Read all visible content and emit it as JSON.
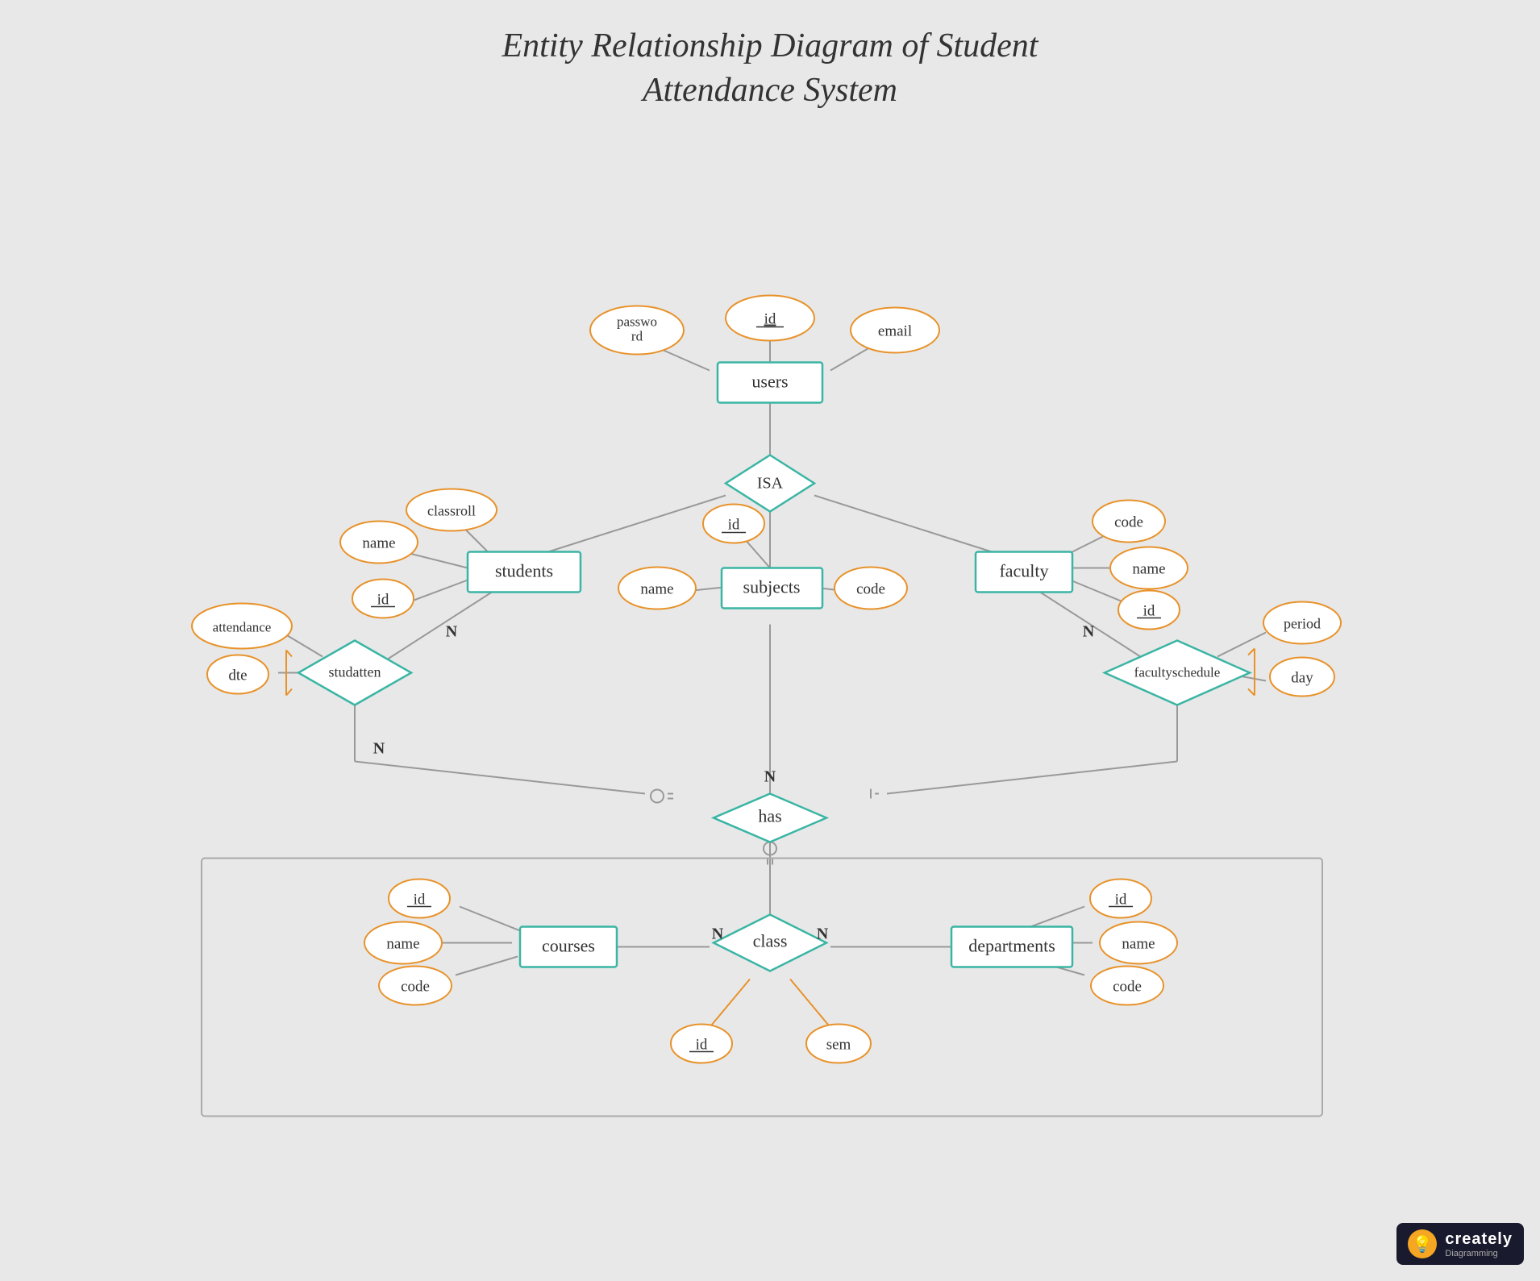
{
  "title": {
    "line1": "Entity Relationship Diagram of Student",
    "line2": "Attendance System"
  },
  "entities": {
    "users": "users",
    "students": "students",
    "faculty": "faculty",
    "subjects": "subjects",
    "courses": "courses",
    "departments": "departments",
    "class_entity": "class"
  },
  "relationships": {
    "isa": "ISA",
    "studatten": "studatten",
    "has": "has",
    "facultyschedule": "facultyschedule"
  },
  "attributes": {
    "users_id": "id",
    "users_password": "password",
    "users_email": "email",
    "students_name": "name",
    "students_id": "id",
    "students_classroll": "classroll",
    "faculty_code": "code",
    "faculty_name": "name",
    "faculty_id": "id",
    "subjects_id": "id",
    "subjects_name": "name",
    "subjects_code": "code",
    "attendance": "attendance",
    "dte": "dte",
    "period": "period",
    "day": "day",
    "courses_id": "id",
    "courses_name": "name",
    "courses_code": "code",
    "departments_id": "id",
    "departments_name": "name",
    "departments_code": "code",
    "class_id": "id",
    "class_sem": "sem"
  },
  "cardinalities": {
    "n": "N"
  },
  "badge": {
    "name": "creately",
    "sub": "Diagramming"
  }
}
